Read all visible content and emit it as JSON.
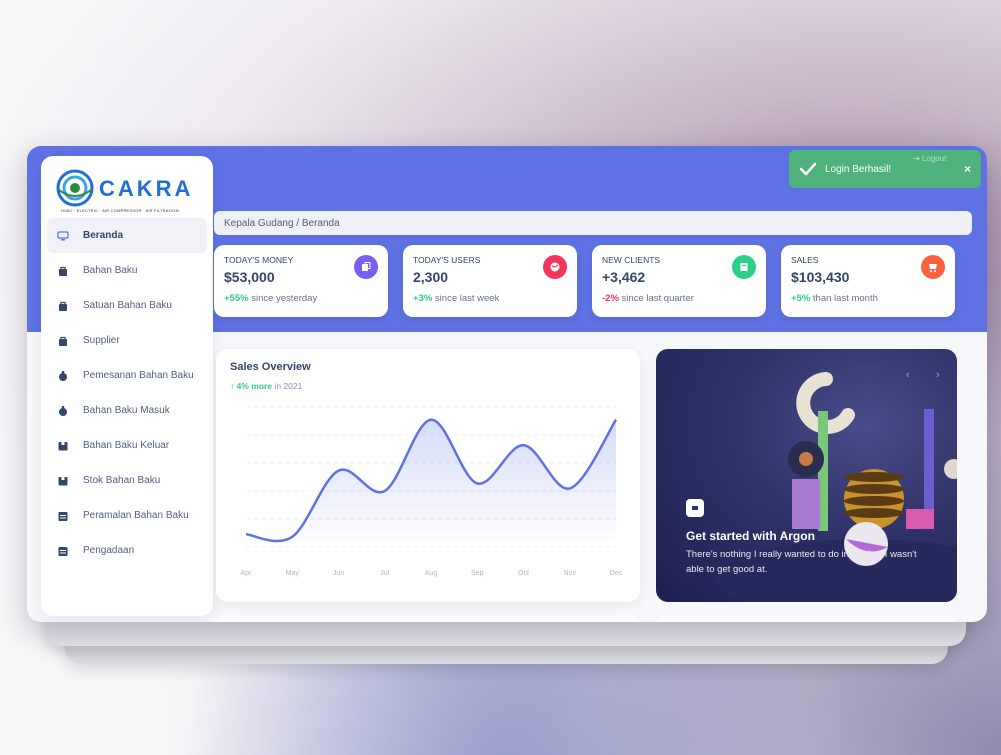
{
  "brand": {
    "name": "CAKRA",
    "sub_lettering": "CAKRA",
    "tagline": "HVAC · ELECTRIC · AIR COMPRESSOR · AIR FILTRATION"
  },
  "toast": {
    "message": "Login Berhasil!",
    "close": "×"
  },
  "logout_label": "Logout",
  "breadcrumb": "Kepala Gudang  /  Beranda",
  "sidebar": {
    "items": [
      {
        "label": "Beranda",
        "icon": "monitor-icon",
        "active": true
      },
      {
        "label": "Bahan Baku",
        "icon": "bag-icon"
      },
      {
        "label": "Satuan Bahan Baku",
        "icon": "bag-icon"
      },
      {
        "label": "Supplier",
        "icon": "bag-icon"
      },
      {
        "label": "Pemesanan Bahan Baku",
        "icon": "gift-icon"
      },
      {
        "label": "Bahan Baku Masuk",
        "icon": "gift-icon"
      },
      {
        "label": "Bahan Baku Keluar",
        "icon": "box-icon"
      },
      {
        "label": "Stok Bahan Baku",
        "icon": "box-icon"
      },
      {
        "label": "Peramalan Bahan Baku",
        "icon": "calendar-icon"
      },
      {
        "label": "Pengadaan",
        "icon": "calendar-icon"
      }
    ]
  },
  "stats": [
    {
      "label": "Today's Money",
      "value": "$53,000",
      "delta": "+55%",
      "delta_type": "pos",
      "note": " since yesterday",
      "icon": "money-icon",
      "color": "#7a5ef0"
    },
    {
      "label": "Today's Users",
      "value": "2,300",
      "delta": "+3%",
      "delta_type": "pos",
      "note": " since last week",
      "icon": "globe-icon",
      "color": "#f5365c"
    },
    {
      "label": "New Clients",
      "value": "+3,462",
      "delta": "-2%",
      "delta_type": "neg",
      "note": " since last quarter",
      "icon": "paper-icon",
      "color": "#2dce89"
    },
    {
      "label": "Sales",
      "value": "$103,430",
      "delta": "+5%",
      "delta_type": "pos",
      "note": " than last month",
      "icon": "cart-icon",
      "color": "#fb6340"
    }
  ],
  "chart": {
    "title": "Sales Overview",
    "subtitle_strong": "4% more",
    "subtitle_rest": " in 2021"
  },
  "chart_data": {
    "type": "line",
    "categories": [
      "Apr",
      "May",
      "Jun",
      "Jul",
      "Aug",
      "Sep",
      "Oct",
      "Nov",
      "Dec"
    ],
    "values": [
      50,
      40,
      300,
      220,
      500,
      250,
      400,
      230,
      500
    ],
    "ylim": [
      0,
      550
    ],
    "grid": true,
    "line_color": "#5e72e4"
  },
  "promo": {
    "title": "Get started with Argon",
    "text": "There's nothing I really wanted to do in life that I wasn't able to get good at.",
    "prev": "‹",
    "next": "›"
  }
}
